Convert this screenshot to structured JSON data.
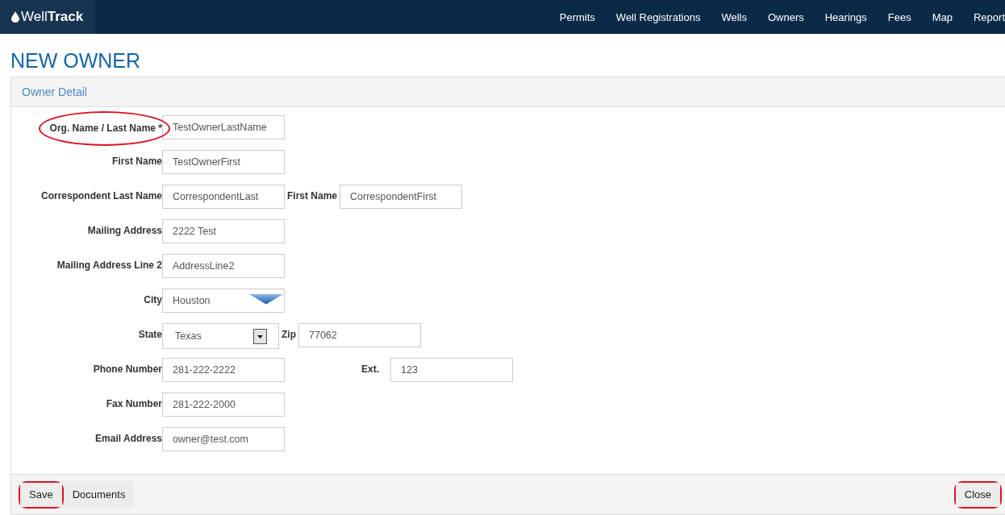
{
  "brand": {
    "light": "Well",
    "bold": "Track"
  },
  "nav": [
    {
      "label": "Permits"
    },
    {
      "label": "Well Registrations"
    },
    {
      "label": "Wells"
    },
    {
      "label": "Owners"
    },
    {
      "label": "Hearings"
    },
    {
      "label": "Fees"
    },
    {
      "label": "Map"
    },
    {
      "label": "Report"
    }
  ],
  "page_title": "NEW OWNER",
  "panel_title": "Owner Detail",
  "rows": [
    {
      "kind": "standard",
      "label": "Org. Name / Last Name *",
      "annotated": true,
      "fields": [
        {
          "kind": "text",
          "value": "TestOwnerLastName"
        }
      ]
    },
    {
      "kind": "standard",
      "label": "First Name",
      "annotated": false,
      "fields": [
        {
          "kind": "text",
          "value": "TestOwnerFirst"
        }
      ]
    },
    {
      "kind": "standard",
      "label": "Correspondent Last Name",
      "annotated": false,
      "fields": [
        {
          "kind": "text",
          "value": "CorrespondentLast"
        },
        {
          "kind": "text",
          "label": "First Name",
          "value": "CorrespondentFirst"
        }
      ]
    },
    {
      "kind": "standard",
      "label": "Mailing Address",
      "annotated": false,
      "fields": [
        {
          "kind": "text",
          "value": "2222 Test"
        }
      ]
    },
    {
      "kind": "standard",
      "label": "Mailing Address Line 2",
      "annotated": false,
      "fields": [
        {
          "kind": "text",
          "value": "AddressLine2"
        }
      ]
    },
    {
      "kind": "standard",
      "label": "City",
      "annotated": false,
      "fields": [
        {
          "kind": "combo",
          "value": "Houston"
        }
      ]
    },
    {
      "kind": "standard",
      "label": "State",
      "annotated": false,
      "fields": [
        {
          "kind": "select",
          "value": "Texas"
        },
        {
          "kind": "text",
          "label": "Zip",
          "value": "77062"
        }
      ]
    },
    {
      "kind": "spaced",
      "label": "Phone Number",
      "annotated": false,
      "fields": [
        {
          "kind": "text",
          "value": "281-222-2222"
        },
        {
          "kind": "text",
          "label": "Ext.",
          "value": "123"
        }
      ]
    },
    {
      "kind": "standard",
      "label": "Fax Number",
      "annotated": false,
      "fields": [
        {
          "kind": "text",
          "value": "281-222-2000"
        }
      ]
    },
    {
      "kind": "standard",
      "label": "Email Address",
      "annotated": false,
      "fields": [
        {
          "kind": "text",
          "value": "owner@test.com"
        }
      ]
    }
  ],
  "footer_left": [
    {
      "label": "Save",
      "annotated": true
    },
    {
      "label": "Documents",
      "annotated": false
    }
  ],
  "footer_right": [
    {
      "label": "Close",
      "annotated": true
    }
  ]
}
